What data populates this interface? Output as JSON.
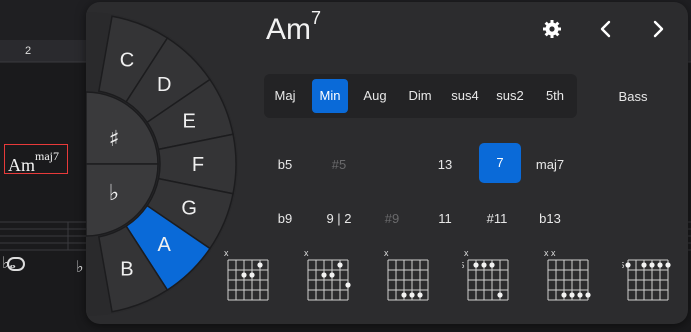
{
  "score": {
    "measure_number": "2",
    "chord_symbol_root": "Am",
    "chord_symbol_ext": "maj7",
    "accent_color": "#e83a3a"
  },
  "header": {
    "chord_root": "Am",
    "chord_ext": "7",
    "settings_icon": "gear-icon",
    "prev_icon": "chevron-left-icon",
    "next_icon": "chevron-right-icon"
  },
  "wheel": {
    "outer": [
      "C",
      "D",
      "E",
      "F",
      "G",
      "A",
      "B"
    ],
    "active": "A",
    "sharp": "♯",
    "flat": "♭",
    "active_color": "#0a6ad8"
  },
  "qualities": [
    {
      "label": "Maj",
      "active": false
    },
    {
      "label": "Min",
      "active": true
    },
    {
      "label": "Aug",
      "active": false
    },
    {
      "label": "Dim",
      "active": false
    },
    {
      "label": "sus4",
      "active": false
    },
    {
      "label": "sus2",
      "active": false
    },
    {
      "label": "5th",
      "active": false
    }
  ],
  "bass_label": "Bass",
  "extensions_row1": [
    {
      "label": "b5",
      "state": "normal"
    },
    {
      "label": "#5",
      "state": "dim"
    },
    {
      "label": "13",
      "state": "normal"
    },
    {
      "label": "7",
      "state": "active"
    },
    {
      "label": "maj7",
      "state": "normal"
    }
  ],
  "extensions_row2": [
    {
      "label": "b9",
      "state": "normal"
    },
    {
      "label": "9 | 2",
      "state": "normal"
    },
    {
      "label": "#9",
      "state": "dim"
    },
    {
      "label": "11",
      "state": "normal"
    },
    {
      "label": "#11",
      "state": "normal"
    },
    {
      "label": "b13",
      "state": "normal"
    }
  ],
  "diagrams": [
    {
      "top": "x",
      "fret": "",
      "dots": [
        [
          5,
          1
        ],
        [
          3,
          2
        ],
        [
          4,
          2
        ]
      ]
    },
    {
      "top": "x",
      "fret": "",
      "dots": [
        [
          5,
          1
        ],
        [
          3,
          2
        ],
        [
          4,
          2
        ],
        [
          6,
          3
        ]
      ]
    },
    {
      "top": "x",
      "fret": "",
      "dots": [
        [
          3,
          4
        ],
        [
          4,
          4
        ],
        [
          5,
          4
        ]
      ]
    },
    {
      "top": "x",
      "fret": "5",
      "dots": [
        [
          2,
          1
        ],
        [
          3,
          1
        ],
        [
          4,
          1
        ],
        [
          5,
          4
        ]
      ]
    },
    {
      "top": "x x",
      "fret": "",
      "dots": [
        [
          3,
          4
        ],
        [
          4,
          4
        ],
        [
          5,
          4
        ],
        [
          6,
          4
        ]
      ]
    },
    {
      "top": "",
      "fret": "5",
      "dots": [
        [
          1,
          1
        ],
        [
          3,
          1
        ],
        [
          4,
          1
        ],
        [
          5,
          1
        ],
        [
          6,
          1
        ]
      ]
    }
  ]
}
